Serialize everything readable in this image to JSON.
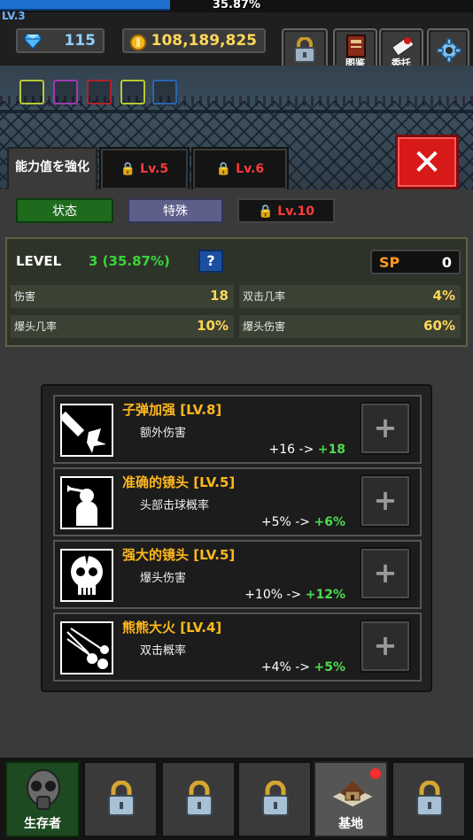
{
  "header": {
    "xp_percent_text": "35.87%",
    "xp_fill_fraction": 0.3587,
    "level": "LV.3",
    "gems": "115",
    "gold": "108,189,825",
    "buttons": {
      "collection": "图鉴",
      "quest": "委托"
    }
  },
  "tabs": {
    "active": "能力值を強化",
    "locked1": "Lv.5",
    "locked2": "Lv.6"
  },
  "subtabs": {
    "status": "状态",
    "special": "特殊",
    "locked": "Lv.10"
  },
  "stats": {
    "level_label": "LEVEL",
    "level_value": "3 (35.87%)",
    "help": "?",
    "sp_label": "SP",
    "sp_value": "0",
    "rows": [
      {
        "label": "伤害",
        "value": "18"
      },
      {
        "label": "双击几率",
        "value": "4%"
      },
      {
        "label": "爆头几率",
        "value": "10%"
      },
      {
        "label": "爆头伤害",
        "value": "60%"
      }
    ]
  },
  "skills": [
    {
      "name": "子弹加强 [LV.8]",
      "desc": "额外伤害",
      "from": "+16 ->",
      "to": "+18"
    },
    {
      "name": "准确的镜头 [LV.5]",
      "desc": "头部击球概率",
      "from": "+5% ->",
      "to": "+6%"
    },
    {
      "name": "强大的镜头 [LV.5]",
      "desc": "爆头伤害",
      "from": "+10% ->",
      "to": "+12%"
    },
    {
      "name": "熊熊大火 [LV.4]",
      "desc": "双击概率",
      "from": "+4% ->",
      "to": "+5%"
    }
  ],
  "nav": {
    "survivor": "生存者",
    "base": "基地"
  },
  "colors": {
    "xp_bar": "#1e6fd0",
    "gold_text": "#ffd75a",
    "gem_text": "#8fd0ff",
    "locked_red": "#ff3b3b",
    "skill_name": "#ffb81c",
    "green_value": "#4cdd4c",
    "close_button": "#d71919"
  }
}
